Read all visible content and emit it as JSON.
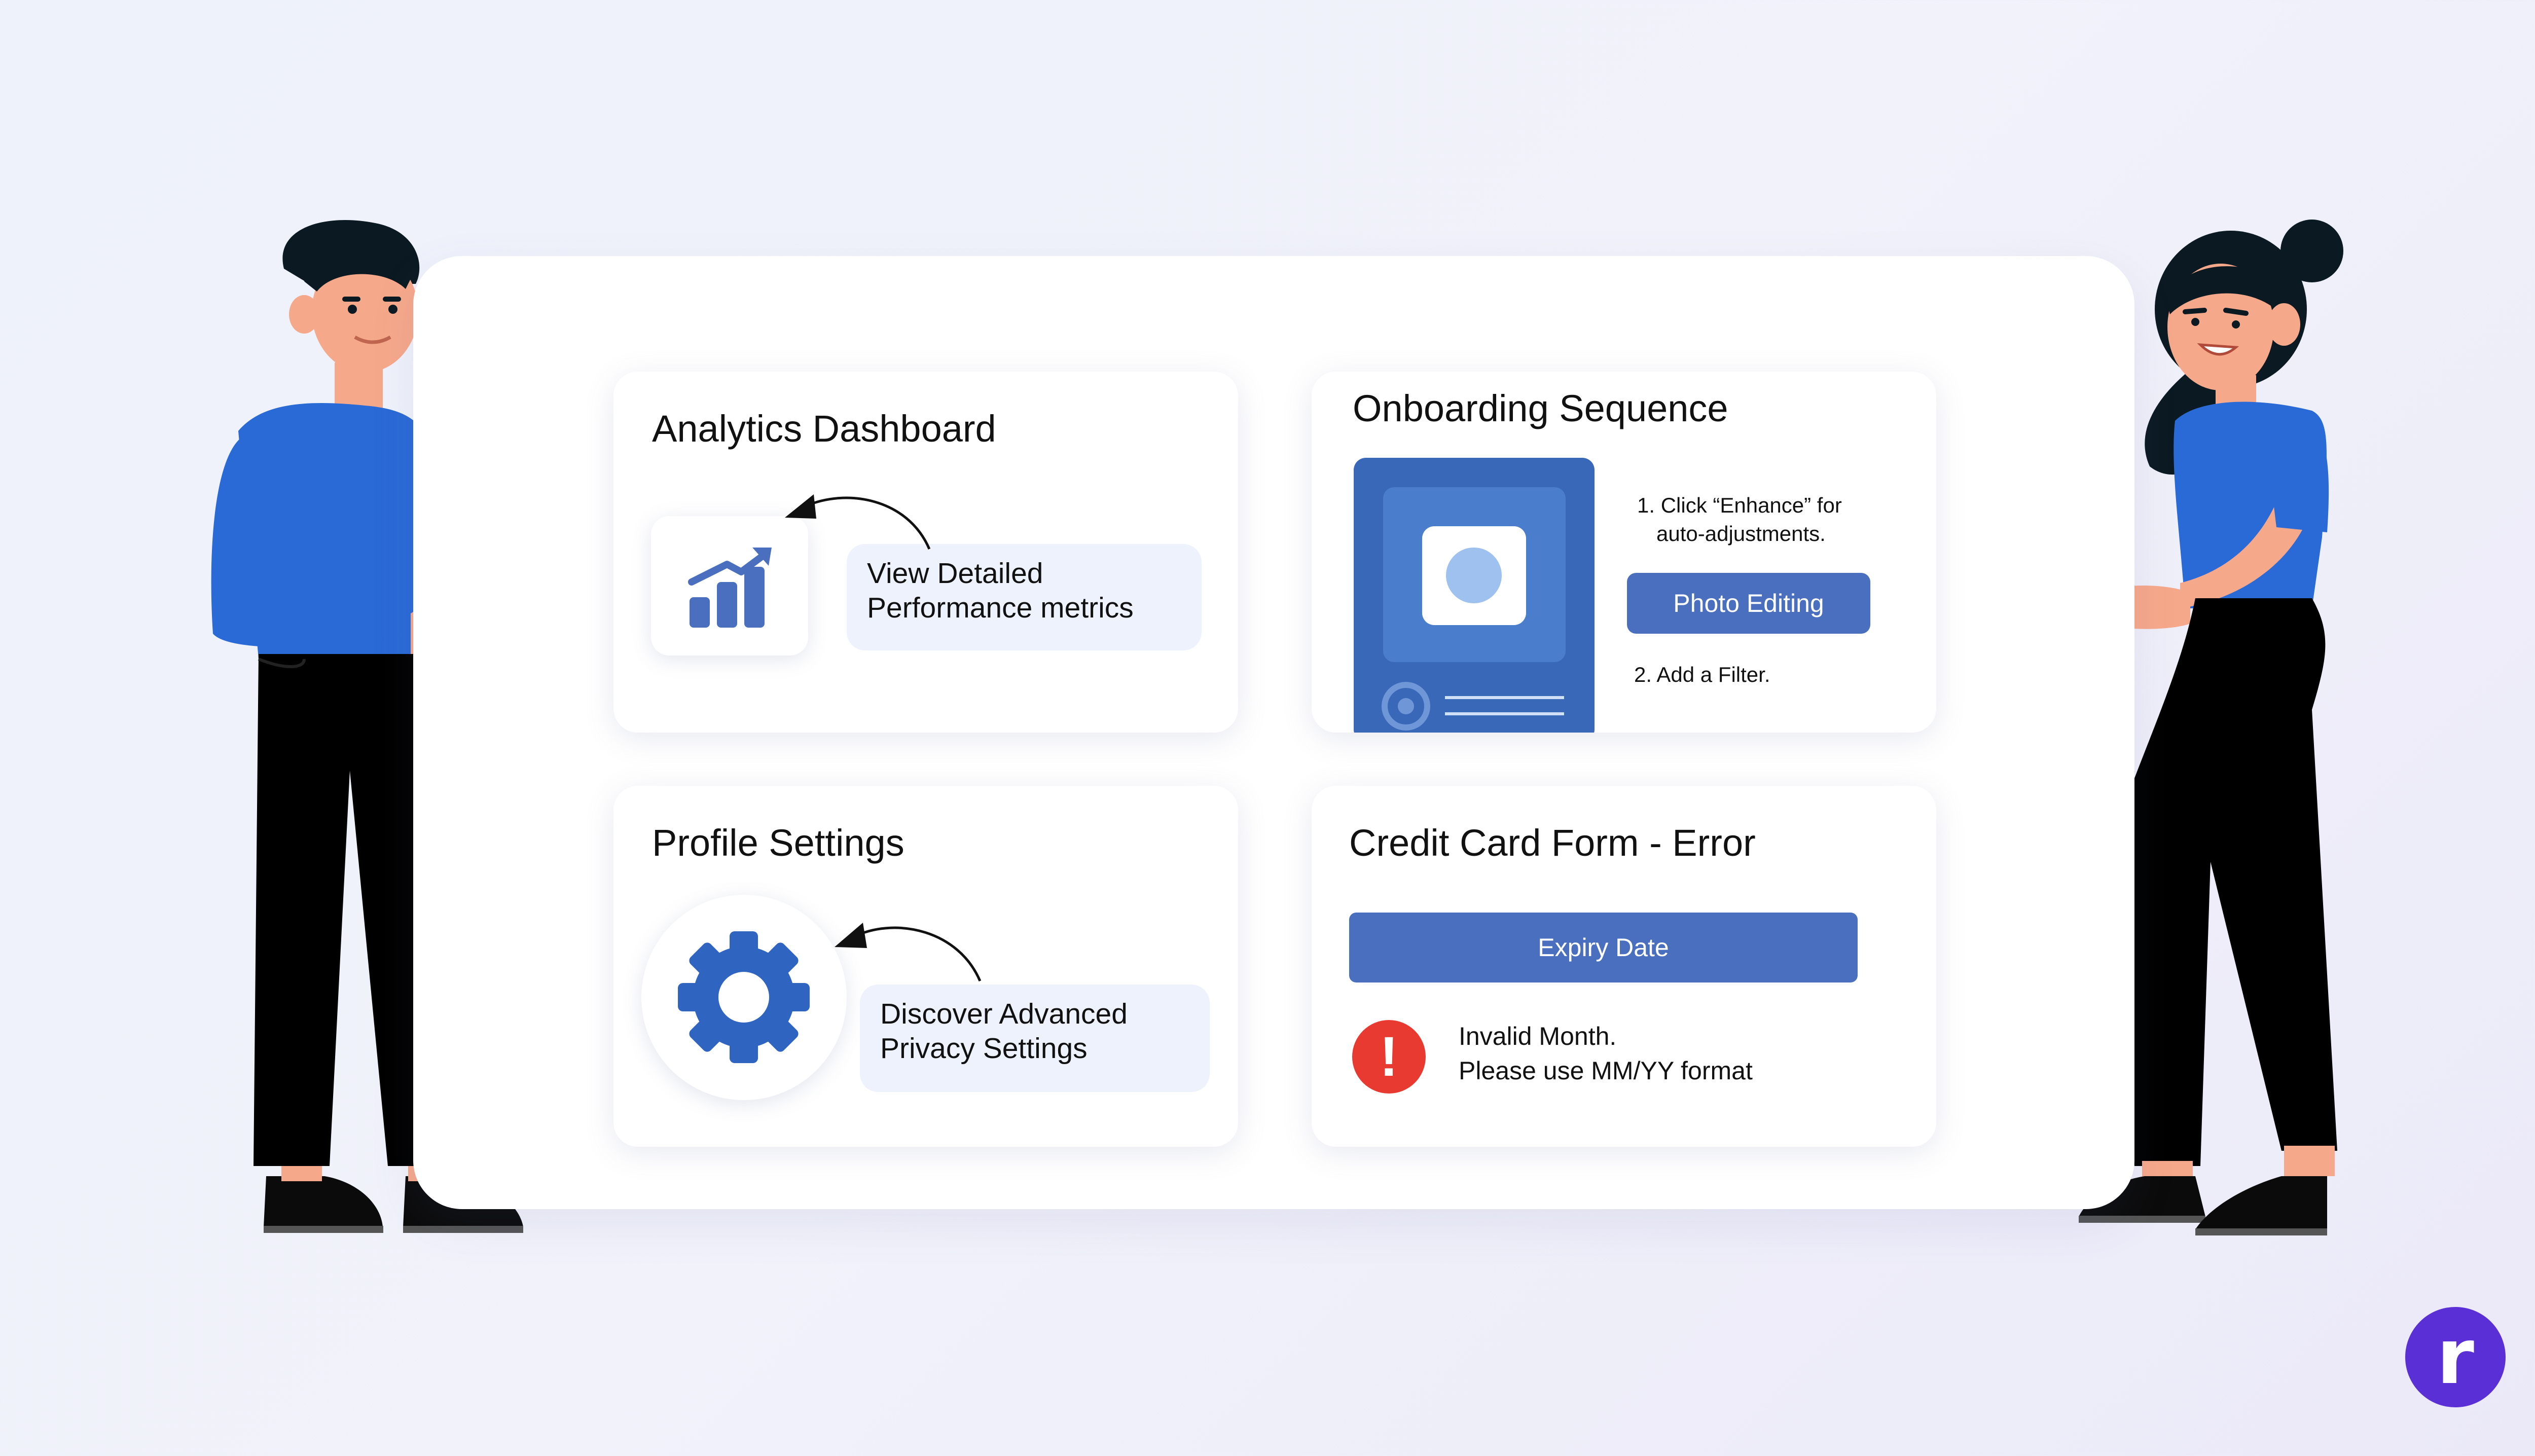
{
  "cards": {
    "analytics": {
      "title": "Analytics Dashboard",
      "callout_line1": "View Detailed",
      "callout_line2": "Performance metrics"
    },
    "onboarding": {
      "title": "Onboarding Sequence",
      "step1_line1": "1. Click “Enhance” for",
      "step1_line2": "auto-adjustments.",
      "button_label": "Photo Editing",
      "step2": "2. Add a Filter."
    },
    "profile": {
      "title": "Profile Settings",
      "callout_line1": "Discover Advanced",
      "callout_line2": "Privacy Settings"
    },
    "credit": {
      "title": "Credit Card Form - Error",
      "button_label": "Expiry Date",
      "error_icon": "!",
      "error_line1": "Invalid Month.",
      "error_line2": "Please use MM/YY format"
    }
  },
  "brand": {
    "logo_letter": "r",
    "logo_color": "#5b2fd6"
  },
  "colors": {
    "accent_blue": "#4a6fbf",
    "shirt_blue": "#2a6ad6",
    "error_red": "#e83a30",
    "callout_bg": "#edf2fd"
  },
  "icons": [
    "bar-chart-growth-icon",
    "gear-icon",
    "image-icon",
    "error-icon"
  ]
}
